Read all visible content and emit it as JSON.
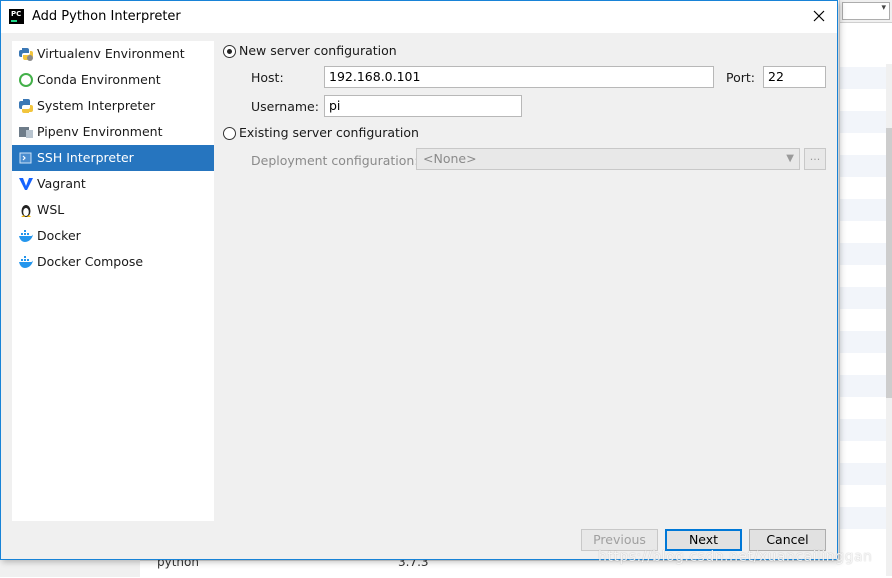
{
  "dialog": {
    "title": "Add Python Interpreter",
    "app_icon_text": "PC",
    "close_symbol": "✕"
  },
  "sidebar": {
    "items": [
      {
        "label": "Virtualenv Environment",
        "icon": "virtualenv-python-icon"
      },
      {
        "label": "Conda Environment",
        "icon": "conda-ring-icon"
      },
      {
        "label": "System Interpreter",
        "icon": "python-icon"
      },
      {
        "label": "Pipenv Environment",
        "icon": "pipenv-icon"
      },
      {
        "label": "SSH Interpreter",
        "icon": "ssh-terminal-icon",
        "selected": true
      },
      {
        "label": "Vagrant",
        "icon": "vagrant-v-icon"
      },
      {
        "label": "WSL",
        "icon": "linux-penguin-icon"
      },
      {
        "label": "Docker",
        "icon": "docker-whale-icon"
      },
      {
        "label": "Docker Compose",
        "icon": "docker-whale-icon"
      }
    ]
  },
  "ssh": {
    "new_config_label": "New server configuration",
    "host_label": "Host:",
    "host_value": "192.168.0.101",
    "port_label": "Port:",
    "port_value": "22",
    "username_label": "Username:",
    "username_value": "pi",
    "existing_config_label": "Existing server configuration",
    "deployment_label": "Deployment configuration:",
    "deployment_value": "<None>",
    "browse_label": "..."
  },
  "buttons": {
    "previous": "Previous",
    "next": "Next",
    "cancel": "Cancel"
  },
  "background": {
    "row_text_1": "python",
    "row_text_2": "3.7.3"
  },
  "watermark": "https://blog.csdn.net/xuancailinggan",
  "colors": {
    "selection": "#2675bf",
    "accent_border": "#0078d7",
    "dialog_bg": "#f0f0f0"
  }
}
